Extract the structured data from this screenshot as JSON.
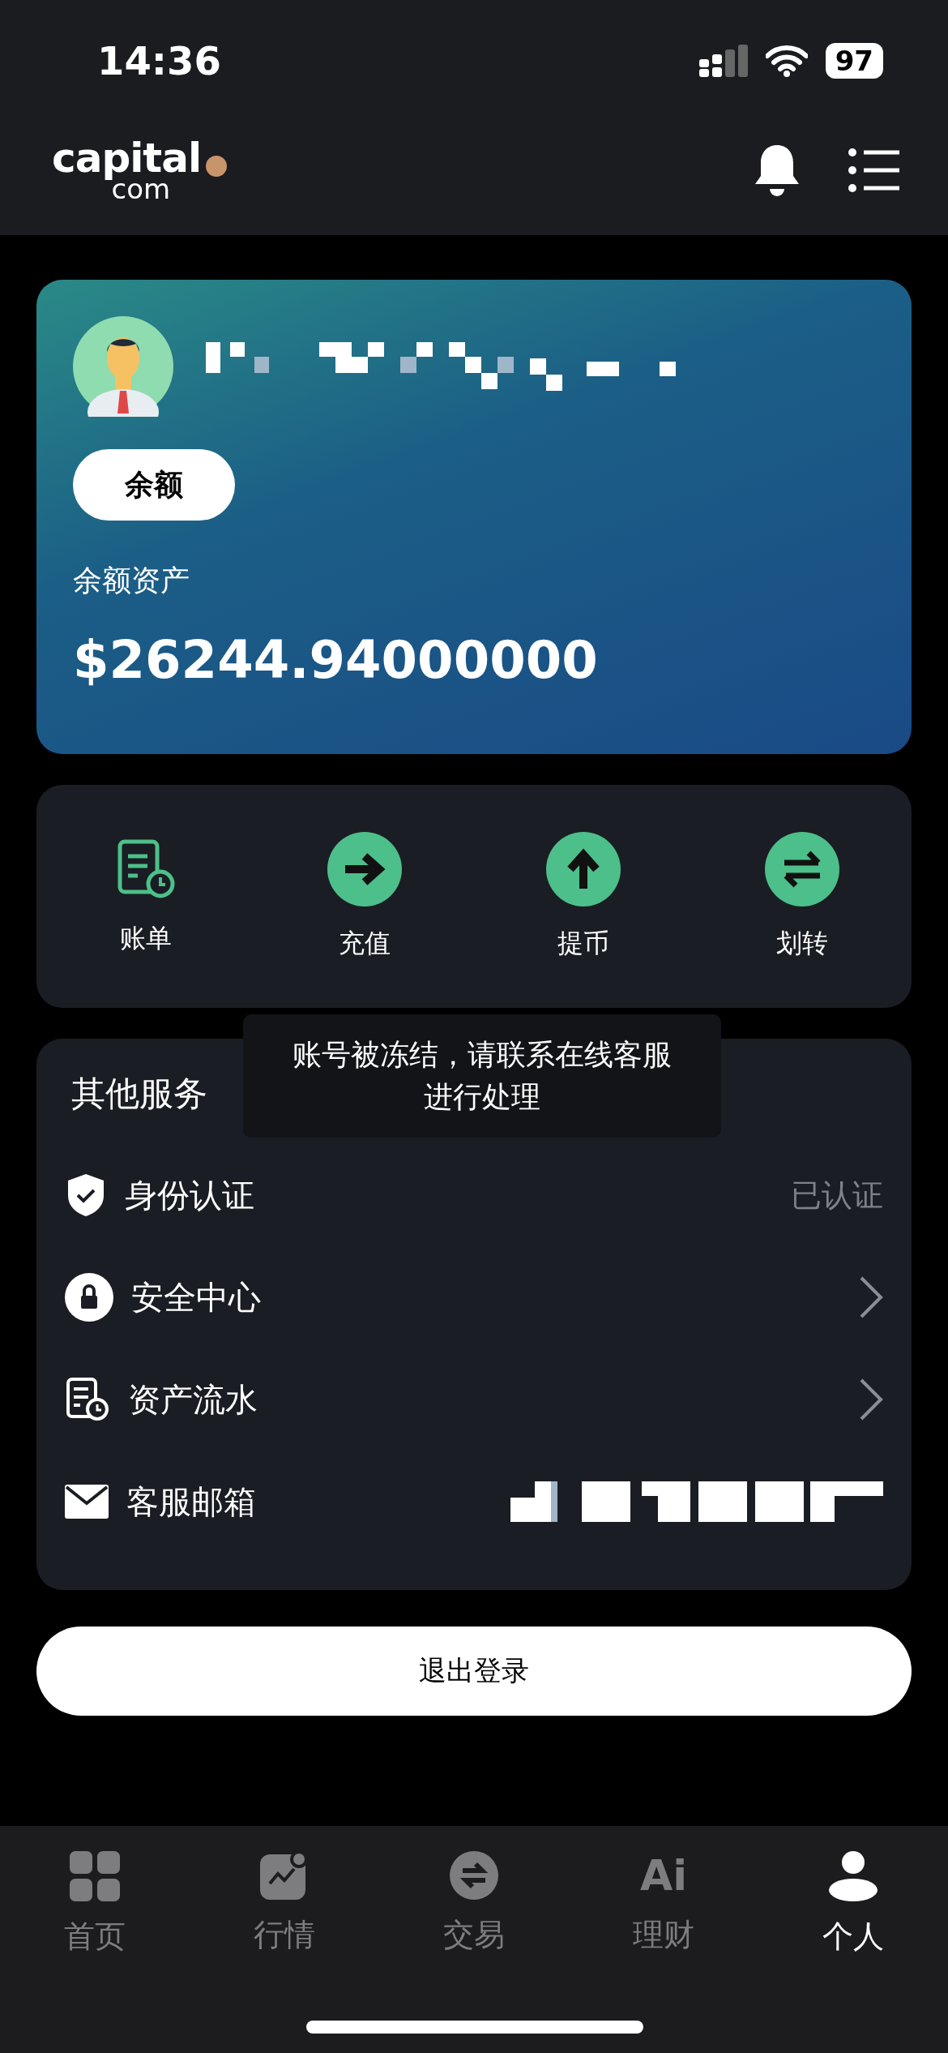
{
  "status_bar": {
    "time": "14:36",
    "battery": "97"
  },
  "header": {
    "logo_main": "capital",
    "logo_sub": "com"
  },
  "balance_card": {
    "tab": "余额",
    "label": "余额资产",
    "amount": "$26244.94000000"
  },
  "actions": [
    {
      "kind": "bill",
      "label": "账单"
    },
    {
      "kind": "deposit",
      "label": "充值"
    },
    {
      "kind": "withdraw",
      "label": "提币"
    },
    {
      "kind": "transfer",
      "label": "划转"
    }
  ],
  "services": {
    "title": "其他服务",
    "items": [
      {
        "kind": "verify",
        "label": "身份认证",
        "value": "已认证"
      },
      {
        "kind": "security",
        "label": "安全中心",
        "chevron": true
      },
      {
        "kind": "ledger",
        "label": "资产流水",
        "chevron": true
      },
      {
        "kind": "email",
        "label": "客服邮箱",
        "redacted": true
      }
    ]
  },
  "toast": "账号被冻结，请联系在线客服进行处理",
  "logout_button": "退出登录",
  "tab_bar": [
    {
      "kind": "home",
      "label": "首页",
      "selected": false
    },
    {
      "kind": "market",
      "label": "行情",
      "selected": false
    },
    {
      "kind": "trade",
      "label": "交易",
      "selected": false
    },
    {
      "kind": "finance",
      "label": "理财",
      "icon_text": "Ai",
      "selected": false
    },
    {
      "kind": "profile",
      "label": "个人",
      "selected": true
    }
  ]
}
